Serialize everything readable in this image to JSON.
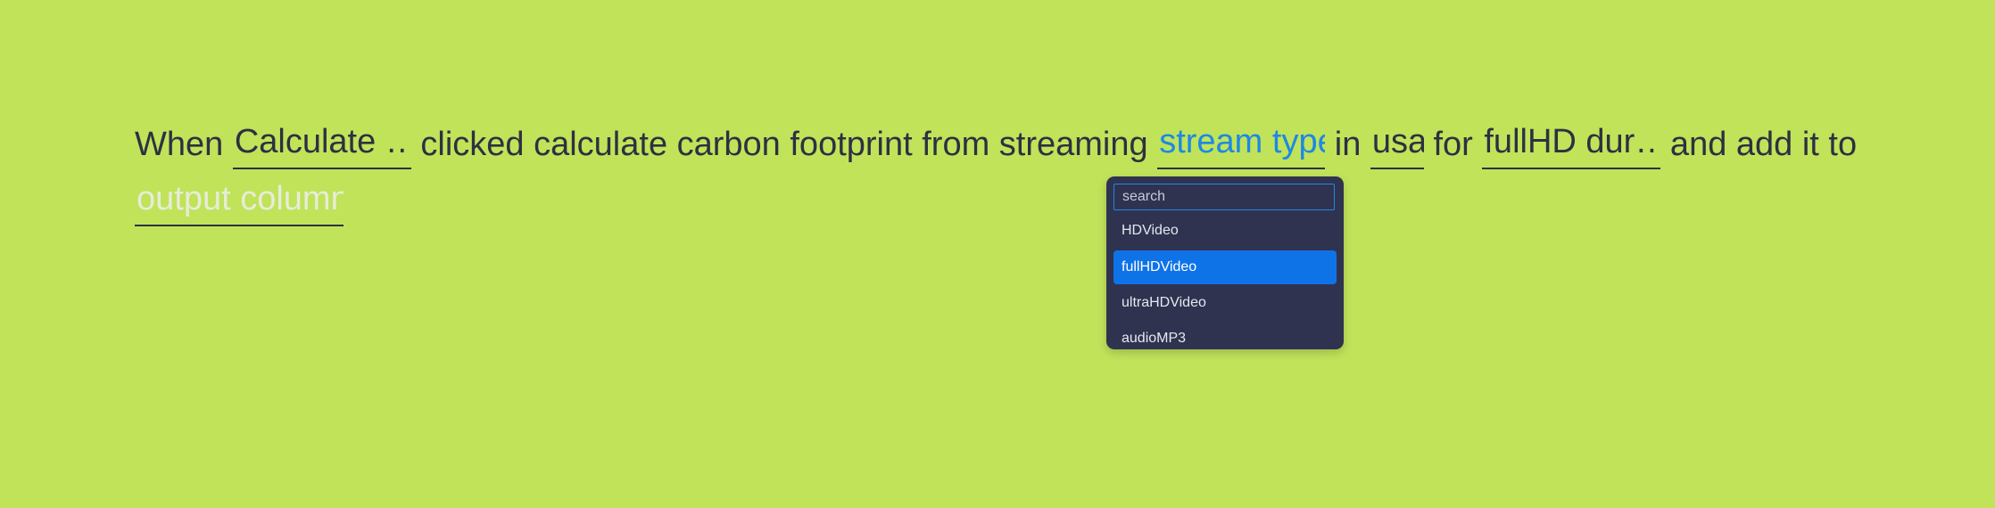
{
  "sentence": {
    "when": "When ",
    "trigger_slot": "Calculate …",
    "clicked_text": " clicked calculate carbon footprint from streaming ",
    "stream_type_slot": "stream type",
    "in_text": " in ",
    "country_slot": "usa",
    "for_text": " for ",
    "duration_slot": "fullHD dur…",
    "add_text": " and add it to ",
    "output_slot": "output column"
  },
  "dropdown": {
    "search_placeholder": "search",
    "options": [
      "HDVideo",
      "fullHDVideo",
      "ultraHDVideo",
      "audioMP3"
    ],
    "selected_index": 1
  },
  "colors": {
    "background": "#c0e35a",
    "text": "#2e3040",
    "accent": "#1e88e5",
    "dropdown_bg": "#2f3350",
    "selected_option": "#0f73e8"
  }
}
